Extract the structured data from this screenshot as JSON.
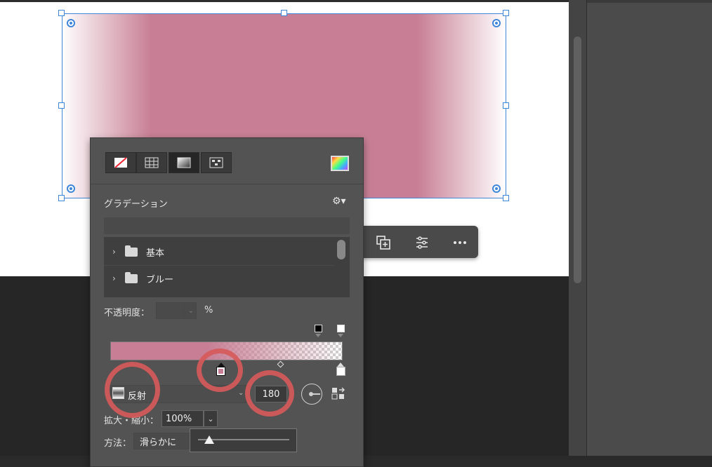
{
  "panel": {
    "title": "グラデーション",
    "type_buttons": [
      "none-icon",
      "pattern-icon",
      "gradient-icon",
      "image-pattern-icon"
    ],
    "folders": [
      {
        "label": "基本"
      },
      {
        "label": "ブルー"
      }
    ],
    "opacity": {
      "label": "不透明度：",
      "value": "",
      "unit": "%"
    },
    "gradient_type": {
      "label": "反射"
    },
    "angle": "180",
    "scale": {
      "label": "拡大・縮小：",
      "value": "100%"
    },
    "method": {
      "label": "方法：",
      "value": "滑らかに"
    },
    "stop_color": "#c87f95"
  },
  "object": {
    "fill_color": "#c87f95"
  },
  "context_bar": {
    "icons": [
      "duplicate-icon",
      "adjustments-icon",
      "more-icon"
    ]
  }
}
